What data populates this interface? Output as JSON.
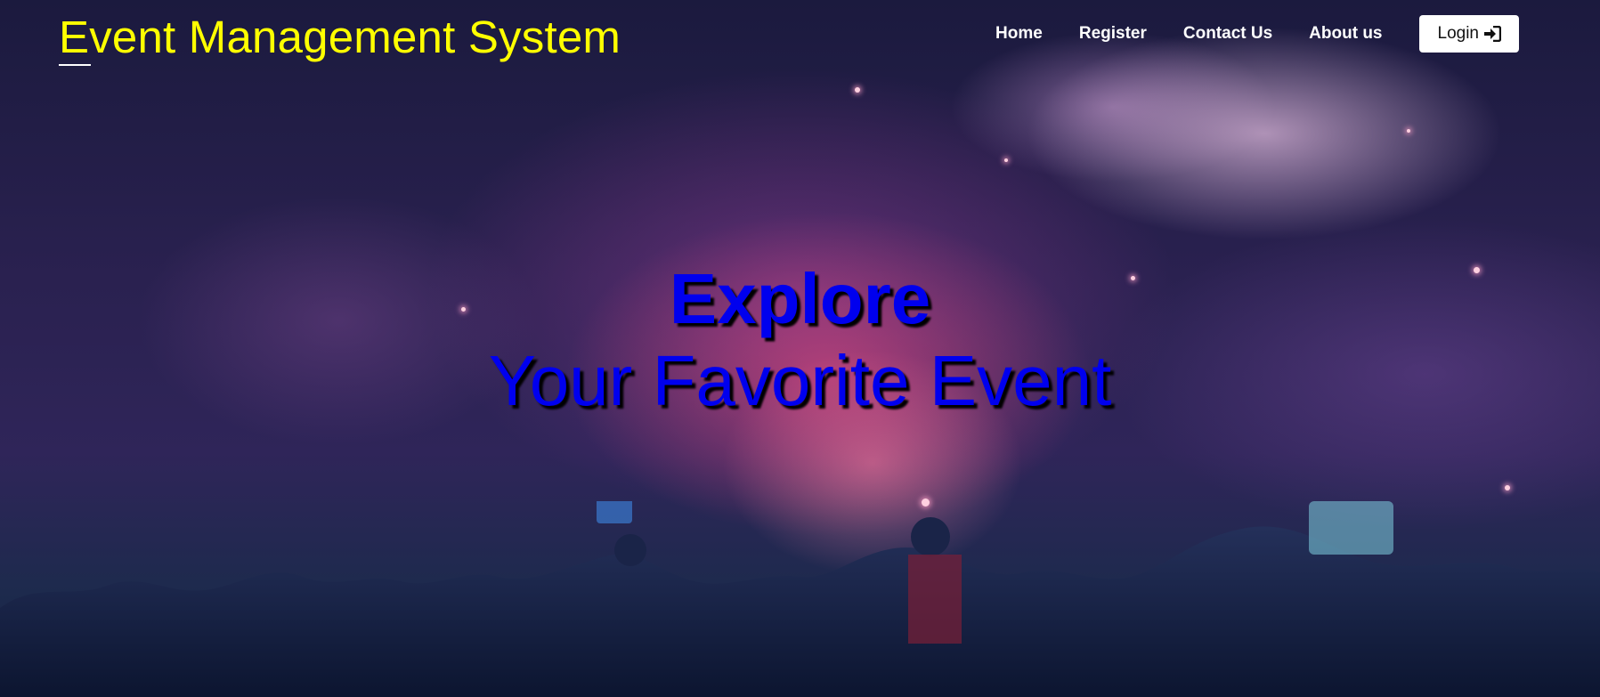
{
  "header": {
    "brand_title": "Event Management System",
    "brand_color": "#ffff00"
  },
  "nav": {
    "items": [
      {
        "label": "Home"
      },
      {
        "label": "Register"
      },
      {
        "label": "Contact Us"
      },
      {
        "label": "About us"
      }
    ],
    "login_label": "Login",
    "login_icon": "sign-in-icon"
  },
  "hero": {
    "headline_line1": "Explore",
    "headline_line2": "Your Favorite Event",
    "headline_color": "#0000ee",
    "background": "fireworks-concert-crowd-photo"
  }
}
